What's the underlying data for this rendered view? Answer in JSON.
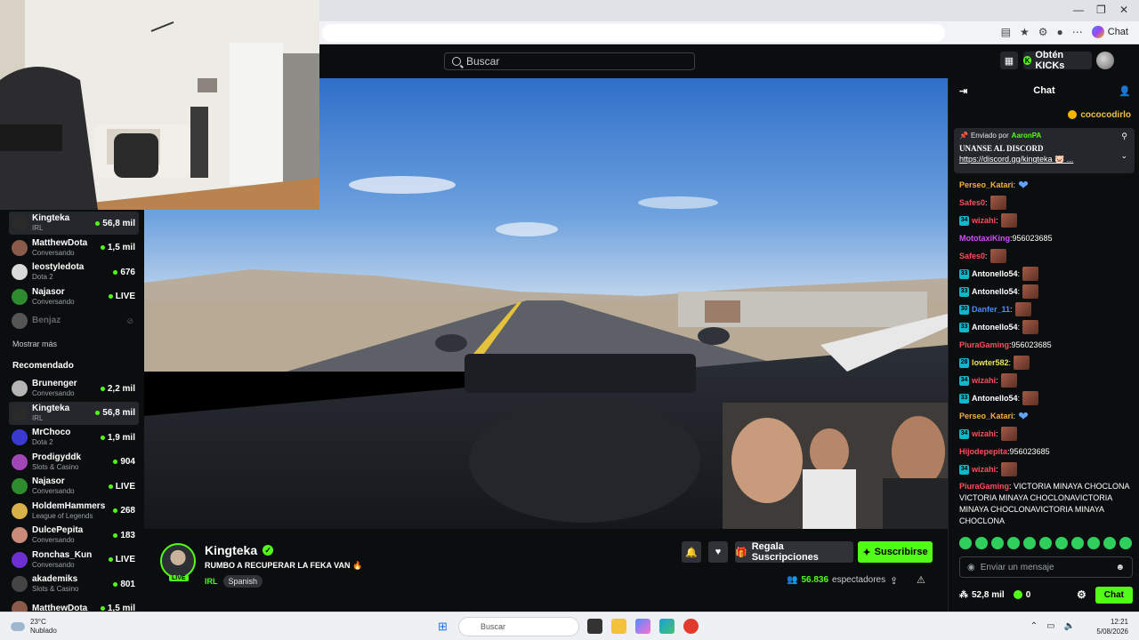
{
  "browser": {
    "window_controls": [
      "—",
      "❐",
      "✕"
    ],
    "chat_pill": "Chat"
  },
  "header": {
    "search_placeholder": "Buscar",
    "kicks_button": "Obtén KICKs"
  },
  "sidebar": {
    "following": [
      {
        "name": "Kingteka",
        "category": "IRL",
        "viewers": "56,8 mil",
        "active": true,
        "color": "#2a2a2a"
      },
      {
        "name": "MatthewDota",
        "category": "Conversando",
        "viewers": "1,5 mil",
        "color": "#8a5a4a"
      },
      {
        "name": "leostyledota",
        "category": "Dota 2",
        "viewers": "676",
        "color": "#d9d9d9"
      },
      {
        "name": "Najasor",
        "category": "Conversando",
        "viewers": "LIVE",
        "color": "#2e8b2e"
      },
      {
        "name": "Benjaz",
        "category": "",
        "viewers": "",
        "offline": true,
        "color": "#555"
      }
    ],
    "show_more": "Mostrar más",
    "recommended_title": "Recomendado",
    "recommended": [
      {
        "name": "Brunenger",
        "category": "Conversando",
        "viewers": "2,2 mil",
        "color": "#b5b5b5"
      },
      {
        "name": "Kingteka",
        "category": "IRL",
        "viewers": "56,8 mil",
        "active": true,
        "color": "#2a2a2a"
      },
      {
        "name": "MrChoco",
        "category": "Dota 2",
        "viewers": "1,9 mil",
        "color": "#3a3ad0"
      },
      {
        "name": "Prodigyddk",
        "category": "Slots & Casino",
        "viewers": "904",
        "color": "#a347b8"
      },
      {
        "name": "Najasor",
        "category": "Conversando",
        "viewers": "LIVE",
        "color": "#2e8b2e"
      },
      {
        "name": "HoldemHammers",
        "category": "League of Legends",
        "viewers": "268",
        "color": "#d8b04a"
      },
      {
        "name": "DulcePepita",
        "category": "Conversando",
        "viewers": "183",
        "color": "#c98a7a"
      },
      {
        "name": "Ronchas_Kun",
        "category": "Conversando",
        "viewers": "LIVE",
        "color": "#6d2fd0"
      },
      {
        "name": "akademiks",
        "category": "Slots & Casino",
        "viewers": "801",
        "color": "#444"
      },
      {
        "name": "MatthewDota",
        "category": "",
        "viewers": "1,5 mil",
        "color": "#8a5a4a"
      }
    ]
  },
  "stream": {
    "live_tag": "LIVE",
    "streamer": "Kingteka",
    "title": "RUMBO A RECUPERAR LA FEKA VAN 🔥",
    "category": "IRL",
    "language": "Spanish",
    "gift_button": "Regala Suscripciones",
    "subscribe_button": "Suscribirse",
    "viewer_count": "56.836",
    "viewer_label": "espectadores"
  },
  "chat": {
    "title": "Chat",
    "top_gifter": "cococodirlo",
    "pinned": {
      "sent_by_label": "Enviado por",
      "sender": "AaronPA",
      "text": "UNANSE AL DISCORD",
      "link": "https://discord.gg/kingteka 🐷 ..."
    },
    "messages": [
      {
        "user": "Perseo_Katari",
        "color": "#f3b03f",
        "text": "",
        "emote": "heart"
      },
      {
        "user": "Safes0",
        "color": "#ff4d5e",
        "text": "",
        "emote": "face"
      },
      {
        "user": "wizahi",
        "color": "#ff4d5e",
        "badge": "34",
        "text": "",
        "emote": "face"
      },
      {
        "user": "MototaxiKing",
        "color": "#d64dff",
        "text": "956023685"
      },
      {
        "user": "Safes0",
        "color": "#ff4d5e",
        "text": "",
        "emote": "face"
      },
      {
        "user": "Antonello54",
        "color": "#ffffff",
        "badge": "33",
        "text": "",
        "emote": "face"
      },
      {
        "user": "Antonello54",
        "color": "#ffffff",
        "badge": "33",
        "text": "",
        "emote": "face"
      },
      {
        "user": "Danfer_11",
        "color": "#4d8dff",
        "badge": "30",
        "text": "",
        "emote": "face"
      },
      {
        "user": "Antonello54",
        "color": "#ffffff",
        "badge": "33",
        "text": "",
        "emote": "face"
      },
      {
        "user": "PiuraGaming",
        "color": "#ff4d5e",
        "text": "956023685"
      },
      {
        "user": "lowter582",
        "color": "#e8e35a",
        "badge": "28",
        "text": "",
        "emote": "face"
      },
      {
        "user": "wizahi",
        "color": "#ff4d5e",
        "badge": "34",
        "text": "",
        "emote": "face"
      },
      {
        "user": "Antonello54",
        "color": "#ffffff",
        "badge": "33",
        "text": "",
        "emote": "face"
      },
      {
        "user": "Perseo_Katari",
        "color": "#f3b03f",
        "text": "",
        "emote": "heart"
      },
      {
        "user": "wizahi",
        "color": "#ff4d5e",
        "badge": "34",
        "text": "",
        "emote": "face"
      },
      {
        "user": "Hijodepepita",
        "color": "#ff4d5e",
        "text": "956023685"
      },
      {
        "user": "wizahi",
        "color": "#ff4d5e",
        "badge": "34",
        "text": "",
        "emote": "face"
      },
      {
        "user": "PiuraGaming",
        "color": "#ff4d5e",
        "text": "VICTORIA MINAYA CHOCLONA VICTORIA MINAYA CHOCLONAVICTORIA MINAYA CHOCLONAVICTORIA MINAYA CHOCLONA",
        "multi": true
      }
    ],
    "input_placeholder": "Enviar un mensaje",
    "kicks_points": "52,8 mil",
    "kicks_balance": "0",
    "send_button": "Chat"
  },
  "taskbar": {
    "temperature": "23°C",
    "weather": "Nublado",
    "search": "Buscar",
    "time": "12:21",
    "date": "5/08/2026"
  },
  "colors": {
    "accent": "#53fc18",
    "bg": "#0b0e0f",
    "panel": "#24272c"
  }
}
